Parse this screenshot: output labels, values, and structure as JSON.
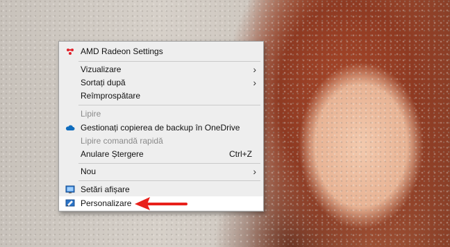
{
  "menu": {
    "amd": {
      "label": "AMD Radeon Settings",
      "icon": "amd-radeon-icon"
    },
    "view": {
      "label": "Vizualizare"
    },
    "sort": {
      "label": "Sortați după"
    },
    "refresh": {
      "label": "Reîmprospătare"
    },
    "paste": {
      "label": "Lipire"
    },
    "onedrive": {
      "label": "Gestionați copierea de backup în OneDrive",
      "icon": "onedrive-cloud-icon"
    },
    "paste_shortcut": {
      "label": "Lipire comandă rapidă"
    },
    "undo": {
      "label": "Anulare Ștergere",
      "shortcut": "Ctrl+Z"
    },
    "new": {
      "label": "Nou"
    },
    "display": {
      "label": "Setări afișare",
      "icon": "display-settings-icon"
    },
    "personalize": {
      "label": "Personalizare",
      "icon": "personalize-icon"
    }
  },
  "colors": {
    "annotation_arrow": "#e8201a",
    "accent": "#0078d7"
  }
}
